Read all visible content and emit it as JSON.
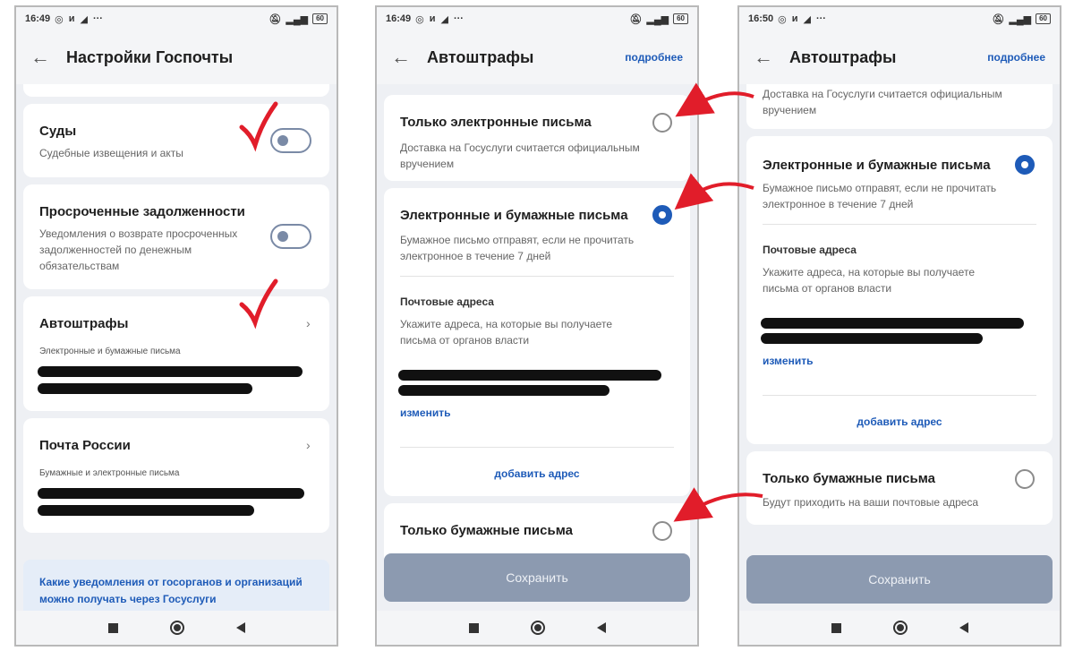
{
  "colors": {
    "accent": "#1e5bb8",
    "annotation": "#e11d2a",
    "save_disabled": "#8c9ab0"
  },
  "screen1": {
    "status": {
      "time": "16:49",
      "icons": [
        "whatsapp-icon",
        "и",
        "telegram-icon",
        "···"
      ],
      "battery": "60"
    },
    "title": "Настройки Госпочты",
    "courts": {
      "title": "Суды",
      "subtitle": "Судебные извещения и акты"
    },
    "debts": {
      "title": "Просроченные задолженности",
      "subtitle_lines": [
        "Уведомления о возврате просроченных",
        "задолженностей по денежным",
        "обязательствам"
      ]
    },
    "autofines": {
      "title": "Автоштрафы",
      "subtitle": "Электронные и бумажные письма"
    },
    "post": {
      "title": "Почта России",
      "subtitle": "Бумажные и электронные письма"
    },
    "info_lines": [
      "Какие уведомления от госорганов и организаций",
      "можно получать через Госуслуги"
    ]
  },
  "screen2": {
    "status": {
      "time": "16:49",
      "icons": [
        "whatsapp-icon",
        "и",
        "telegram-icon",
        "···"
      ],
      "battery": "60"
    },
    "title": "Автоштрафы",
    "more": "подробнее",
    "opt_electronic": {
      "title": "Только электронные письма",
      "subtitle_lines": [
        "Доставка на Госуслуги считается официальным",
        "вручением"
      ]
    },
    "opt_both": {
      "title": "Электронные и бумажные письма",
      "subtitle_lines": [
        "Бумажное письмо отправят, если не прочитать",
        "электронное в течение 7 дней"
      ]
    },
    "addresses": {
      "title": "Почтовые адреса",
      "subtitle_lines": [
        "Укажите адреса, на которые вы получаете",
        "письма от органов власти"
      ]
    },
    "change": "изменить",
    "add_address": "добавить адрес",
    "opt_paper": {
      "title": "Только бумажные письма"
    },
    "save": "Сохранить"
  },
  "screen3": {
    "status": {
      "time": "16:50",
      "icons": [
        "whatsapp-icon",
        "и",
        "telegram-icon",
        "···"
      ],
      "battery": "60"
    },
    "title": "Автоштрафы",
    "more": "подробнее",
    "opt_electronic_partial_lines": [
      "Доставка на Госуслуги считается официальным",
      "вручением"
    ],
    "opt_both": {
      "title": "Электронные и бумажные письма",
      "subtitle_lines": [
        "Бумажное письмо отправят, если не прочитать",
        "электронное в течение 7 дней"
      ]
    },
    "addresses": {
      "title": "Почтовые адреса",
      "subtitle_lines": [
        "Укажите адреса, на которые вы получаете",
        "письма от органов власти"
      ]
    },
    "change": "изменить",
    "add_address": "добавить адрес",
    "opt_paper": {
      "title": "Только бумажные письма",
      "subtitle": "Будут приходить на ваши почтовые адреса"
    },
    "save": "Сохранить"
  }
}
